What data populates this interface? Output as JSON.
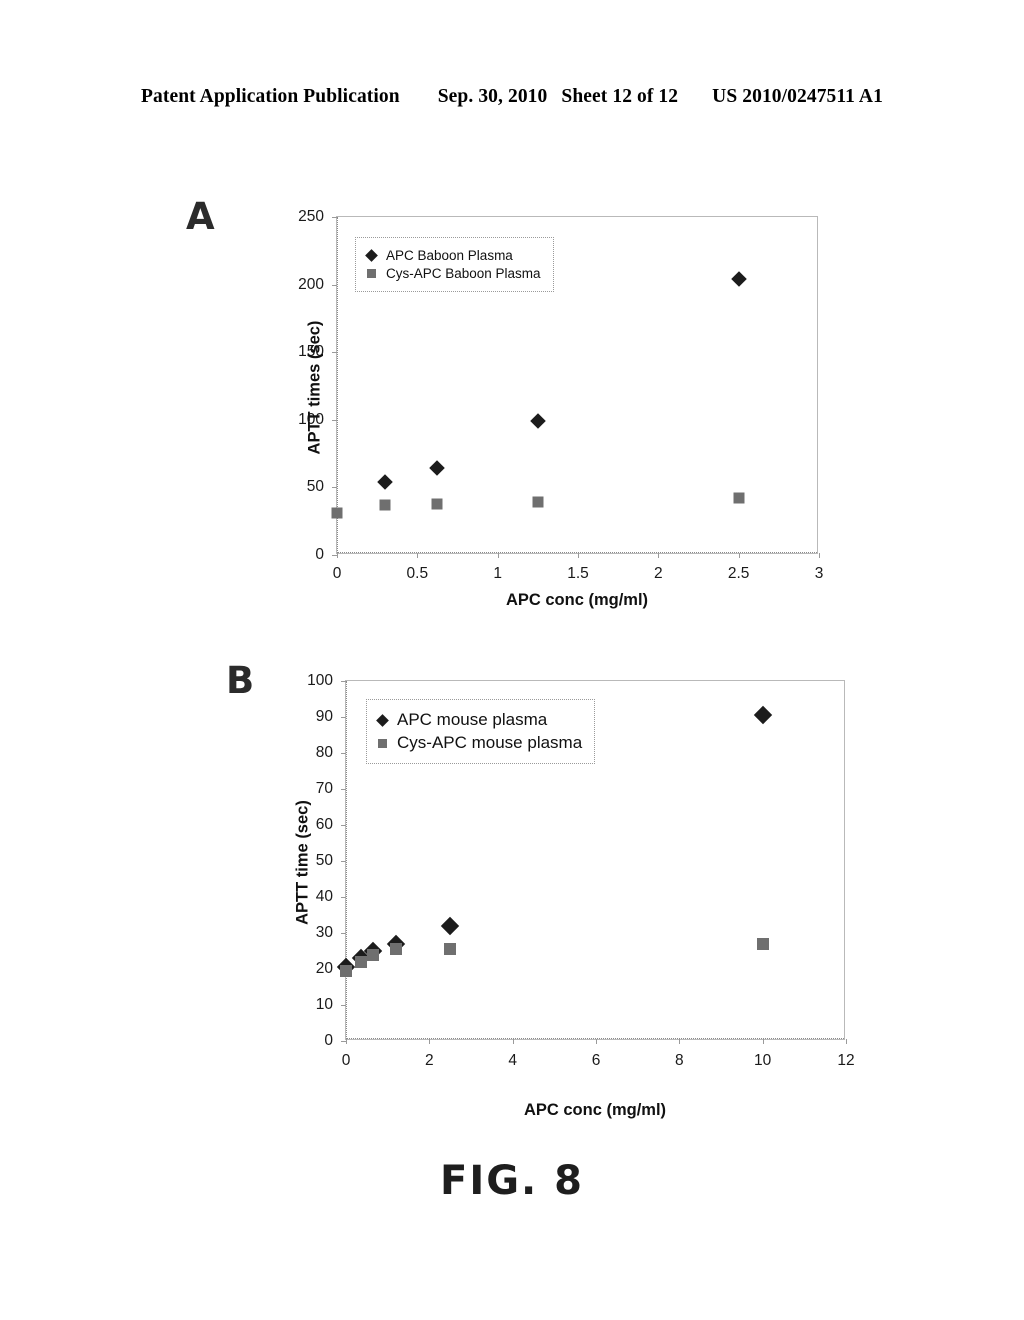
{
  "header": {
    "publication": "Patent Application Publication",
    "date": "Sep. 30, 2010",
    "sheet": "Sheet 12 of 12",
    "patent_number": "US 2010/0247511 A1"
  },
  "figure": {
    "caption": "FIG. 8",
    "panel_a_label": "A",
    "panel_b_label": "B"
  },
  "colors": {
    "apc_marker": "#1c1c1c",
    "cys_apc_marker": "#6f6f6f",
    "axis": "#8a8a8a",
    "frame": "#b9b9b9"
  },
  "chart_data": [
    {
      "panel": "A",
      "type": "scatter",
      "title": "",
      "xlabel": "APC conc (mg/ml)",
      "ylabel": "APTT times (sec)",
      "xlim": [
        0,
        3
      ],
      "ylim": [
        0,
        250
      ],
      "xticks": [
        "0",
        "0.5",
        "1",
        "1.5",
        "2",
        "2.5",
        "3"
      ],
      "xtick_values": [
        0,
        0.5,
        1,
        1.5,
        2,
        2.5,
        3
      ],
      "yticks": [
        "0",
        "50",
        "100",
        "150",
        "200",
        "250"
      ],
      "ytick_values": [
        0,
        50,
        100,
        150,
        200,
        250
      ],
      "grid": false,
      "legend_position": "top-left",
      "series": [
        {
          "name": "APC Baboon Plasma",
          "marker": "diamond",
          "color": "#1c1c1c",
          "points": [
            {
              "x": 0.3,
              "y": 54
            },
            {
              "x": 0.62,
              "y": 64
            },
            {
              "x": 1.25,
              "y": 99
            },
            {
              "x": 2.5,
              "y": 204
            }
          ]
        },
        {
          "name": "Cys-APC Baboon Plasma",
          "marker": "square",
          "color": "#6f6f6f",
          "points": [
            {
              "x": 0.0,
              "y": 31
            },
            {
              "x": 0.3,
              "y": 37
            },
            {
              "x": 0.62,
              "y": 38
            },
            {
              "x": 1.25,
              "y": 39
            },
            {
              "x": 2.5,
              "y": 42
            }
          ]
        }
      ]
    },
    {
      "panel": "B",
      "type": "scatter",
      "title": "",
      "xlabel": "APC conc (mg/ml)",
      "ylabel": "APTT time (sec)",
      "xlim": [
        0,
        12
      ],
      "ylim": [
        0,
        100
      ],
      "xticks": [
        "0",
        "2",
        "4",
        "6",
        "8",
        "10",
        "12"
      ],
      "xtick_values": [
        0,
        2,
        4,
        6,
        8,
        10,
        12
      ],
      "yticks": [
        "0",
        "10",
        "20",
        "30",
        "40",
        "50",
        "60",
        "70",
        "80",
        "90",
        "100"
      ],
      "ytick_values": [
        0,
        10,
        20,
        30,
        40,
        50,
        60,
        70,
        80,
        90,
        100
      ],
      "grid": false,
      "legend_position": "top-left",
      "series": [
        {
          "name": "APC mouse plasma",
          "marker": "diamond",
          "color": "#1c1c1c",
          "points": [
            {
              "x": 0.0,
              "y": 20.5
            },
            {
              "x": 0.35,
              "y": 23
            },
            {
              "x": 0.65,
              "y": 25
            },
            {
              "x": 1.2,
              "y": 27
            },
            {
              "x": 2.5,
              "y": 32
            },
            {
              "x": 10.0,
              "y": 90.5
            }
          ]
        },
        {
          "name": "Cys-APC mouse plasma",
          "marker": "square",
          "color": "#6f6f6f",
          "points": [
            {
              "x": 0.0,
              "y": 19.5
            },
            {
              "x": 0.35,
              "y": 22
            },
            {
              "x": 0.65,
              "y": 24
            },
            {
              "x": 1.2,
              "y": 25.5
            },
            {
              "x": 2.5,
              "y": 25.5
            },
            {
              "x": 10.0,
              "y": 27
            }
          ]
        }
      ]
    }
  ]
}
